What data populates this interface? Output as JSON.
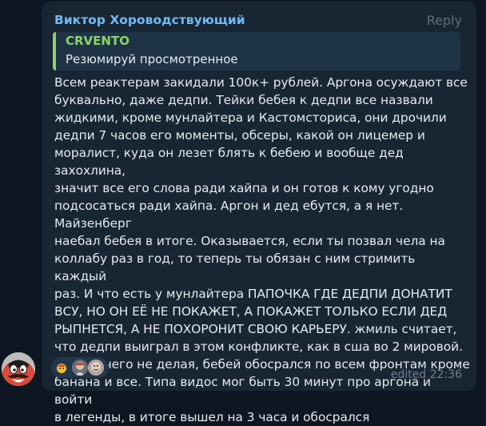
{
  "message": {
    "sender": "Виктор Хороводствующий",
    "reply_label": "Reply",
    "quote": {
      "author": "CRVENTO",
      "text": "Резюмируй просмотренное"
    },
    "lines": [
      "Всем реактерам закидали 100к+ рублей. Аргона осуждают все",
      "буквально, даже дедпи. Тейки бебея к дедпи все назвали",
      "жидкими, кроме мунлайтера и Кастомсториса, они дрочили",
      "дедпи 7 часов его моменты, обсеры, какой он лицемер и",
      "моралист, куда он лезет блять к бебею и вообще дед захохлина,",
      "значит все его слова ради хайпа и он готов к кому угодно",
      "подсосаться ради хайпа. Аргон и дед ебутся, а я нет. Майзенберг",
      "наебал бебея в итоге. Оказывается, если ты позвал чела на",
      "коллабу раз в год, то теперь ты обязан с ним стримить каждый",
      "раз. И что есть у мунлайтера ПАПОЧКА ГДЕ ДЕДПИ ДОНАТИТ",
      "ВСУ, НО ОН ЕЁ НЕ ПОКАЖЕТ, А ПОКАЖЕТ ТОЛЬКО ЕСЛИ ДЕД",
      "РЫПНЕТСЯ, А НЕ ПОХОРОНИТ СВОЮ КАРЬЕРУ. жмиль считает,",
      "что дедпи выиграл в этом конфликте, как в сша во 2 мировой.",
      "Тупо ничего не делая, бебей обосрался по всем фронтам кроме",
      "банана и все. Типа видос мог быть 30 минут про аргона и войти",
      "в легенды, в итоге вышел на 3 часа и обосрался"
    ],
    "edited_time": "edited 22:36"
  },
  "reactions": {
    "icons": [
      "reaction-emoji-icon",
      "reactor-avatar-1",
      "reactor-avatar-2"
    ]
  },
  "colors": {
    "background": "#0e1621",
    "bubble": "#182533",
    "sender": "#71baf2",
    "quote_accent": "#8bd36a",
    "text": "#e6ebef",
    "meta": "#6d7f8f"
  }
}
